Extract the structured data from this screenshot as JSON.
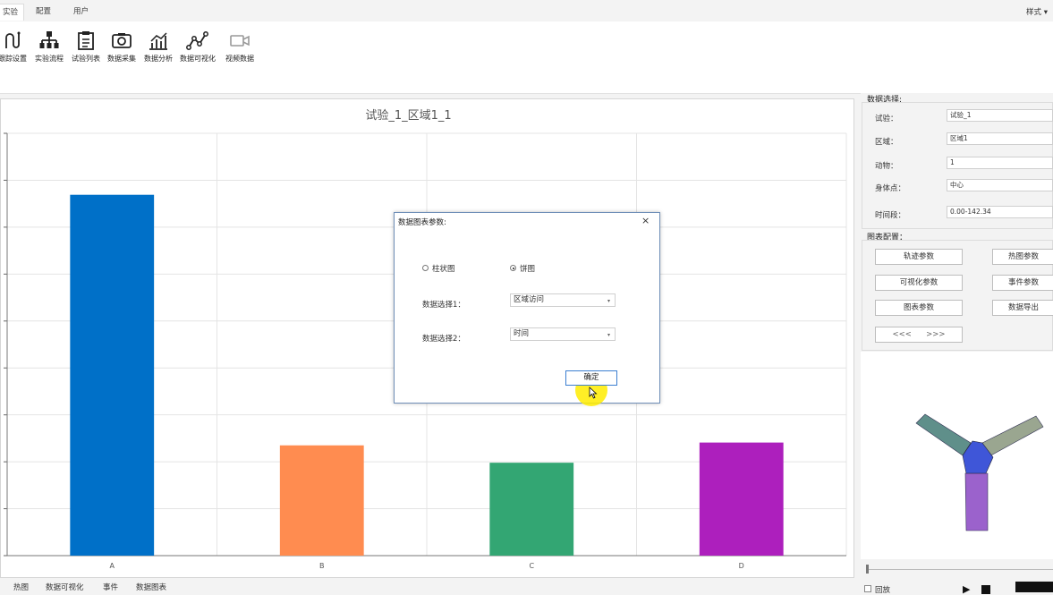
{
  "tabs": {
    "t1": "实验",
    "t2": "配置",
    "t3": "用户"
  },
  "style_label": "样式",
  "ribbon": {
    "b1": "跟踪设置",
    "b2": "实验流程",
    "b3": "试验列表",
    "b4": "数据采集",
    "b5": "数据分析",
    "b6": "数据可视化",
    "b7": "视频数据"
  },
  "bottom_tabs": {
    "t1": "热图",
    "t2": "数据可视化",
    "t3": "事件",
    "t4": "数据图表"
  },
  "chart_data": {
    "type": "bar",
    "title": "试验_1_区域1_1",
    "categories": [
      "A",
      "B",
      "C",
      "D"
    ],
    "values": [
      76.9,
      23.5,
      19.8,
      24.1
    ],
    "colors": [
      "#0070c8",
      "#ff8c50",
      "#33a673",
      "#ad1fbd"
    ],
    "ylim": [
      0,
      90
    ],
    "grid": true
  },
  "right": {
    "data_select": "数据选择:",
    "trial_label": "试验：",
    "trial_value": "试验_1",
    "zone_label": "区域：",
    "zone_value": "区域1",
    "animal_label": "动物：",
    "animal_value": "1",
    "bodypoint_label": "身体点：",
    "bodypoint_value": "中心",
    "period_label": "时间段：",
    "period_value": "0.00-142.34",
    "chart_config": "图表配置：",
    "btn_track": "轨迹参数",
    "btn_heat": "热图参数",
    "btn_vis": "可视化参数",
    "btn_event": "事件参数",
    "btn_chart": "图表参数",
    "btn_export": "数据导出",
    "btn_nav": "<<<      >>>",
    "replay": "回放"
  },
  "dialog": {
    "title": "数据图表参数:",
    "close": "×",
    "radio_bar": "柱状图",
    "radio_pie": "饼图",
    "sel1_label": "数据选择1：",
    "sel1_value": "区域访问",
    "sel2_label": "数据选择2：",
    "sel2_value": "时间",
    "ok": "确定"
  },
  "colors": {
    "accent": "#3c7fd1",
    "dialog_border": "#6f8fb8"
  }
}
